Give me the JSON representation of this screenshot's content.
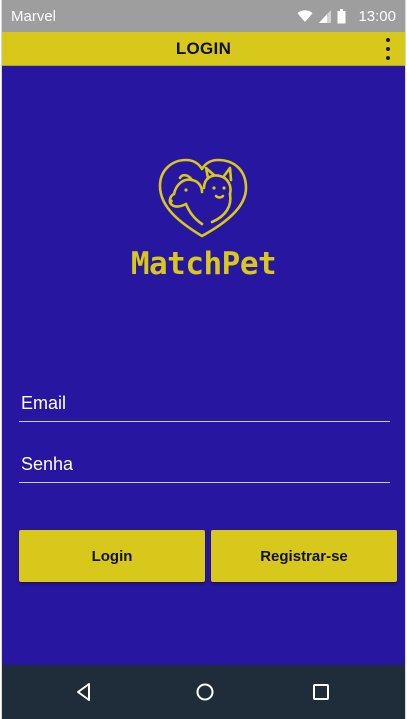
{
  "status_bar": {
    "carrier": "Marvel",
    "time": "13:00",
    "icons": [
      "wifi-icon",
      "signal-icon",
      "battery-icon"
    ]
  },
  "app_bar": {
    "title": "LOGIN",
    "menu_icon": "overflow-menu-icon"
  },
  "brand": {
    "name": "MatchPet",
    "logo_icon": "pet-heart-logo"
  },
  "form": {
    "email": {
      "value": "",
      "placeholder": "Email"
    },
    "password": {
      "value": "",
      "placeholder": "Senha"
    }
  },
  "buttons": {
    "login_label": "Login",
    "register_label": "Registrar-se"
  },
  "nav_bar": {
    "icons": [
      "back-icon",
      "home-icon",
      "recent-apps-icon"
    ]
  },
  "colors": {
    "background": "#2716a0",
    "accent": "#d7c81b",
    "status_bar": "#9e9e9e",
    "nav_bar": "#1f2d3a"
  }
}
